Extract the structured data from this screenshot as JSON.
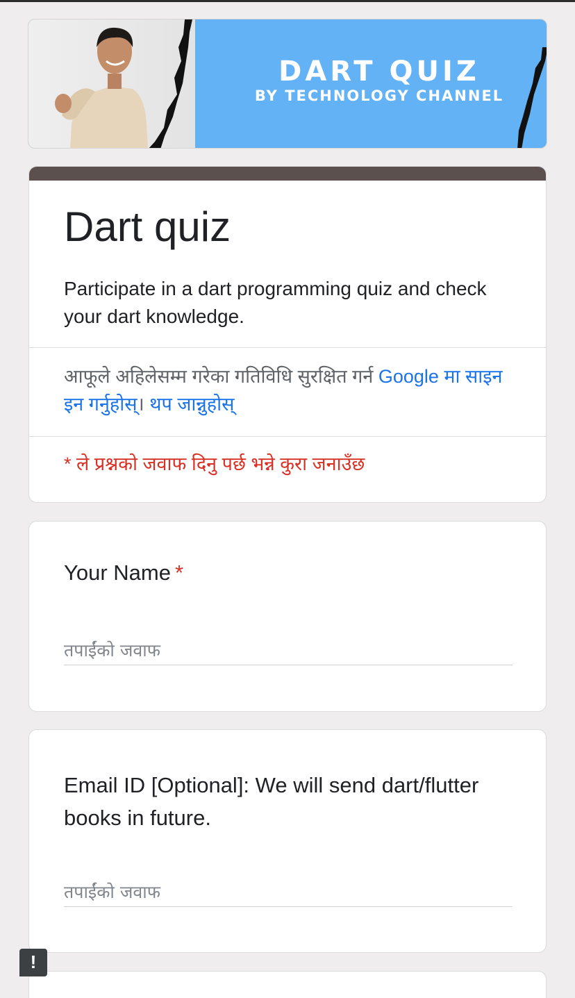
{
  "banner": {
    "title": "DART QUIZ",
    "subtitle": "BY TECHNOLOGY CHANNEL"
  },
  "header": {
    "title": "Dart quiz",
    "description": "Participate in a dart programming quiz and check your dart knowledge.",
    "signin_text": "आफूले अहिलेसम्म गरेका गतिविधि सुरक्षित गर्न ",
    "signin_link": "Google मा साइन इन गर्नुहोस्",
    "signin_sep": "। ",
    "learn_more": "थप जान्नुहोस्",
    "required_note": "* ले प्रश्नको जवाफ दिनु पर्छ भन्ने कुरा जनाउँछ",
    "band_color": "#5b504d"
  },
  "questions": [
    {
      "title": "Your Name",
      "required_mark": "*",
      "placeholder": "तपाईंको जवाफ",
      "value": ""
    },
    {
      "title": "Email ID [Optional]: We will send dart/flutter books in future.",
      "placeholder": "तपाईंको जवाफ",
      "value": ""
    }
  ],
  "feedback": {
    "icon": "report-icon",
    "glyph": "!"
  },
  "colors": {
    "background": "#efedee",
    "banner": "#63b2f6",
    "link": "#1a73e8",
    "required": "#d93025"
  }
}
